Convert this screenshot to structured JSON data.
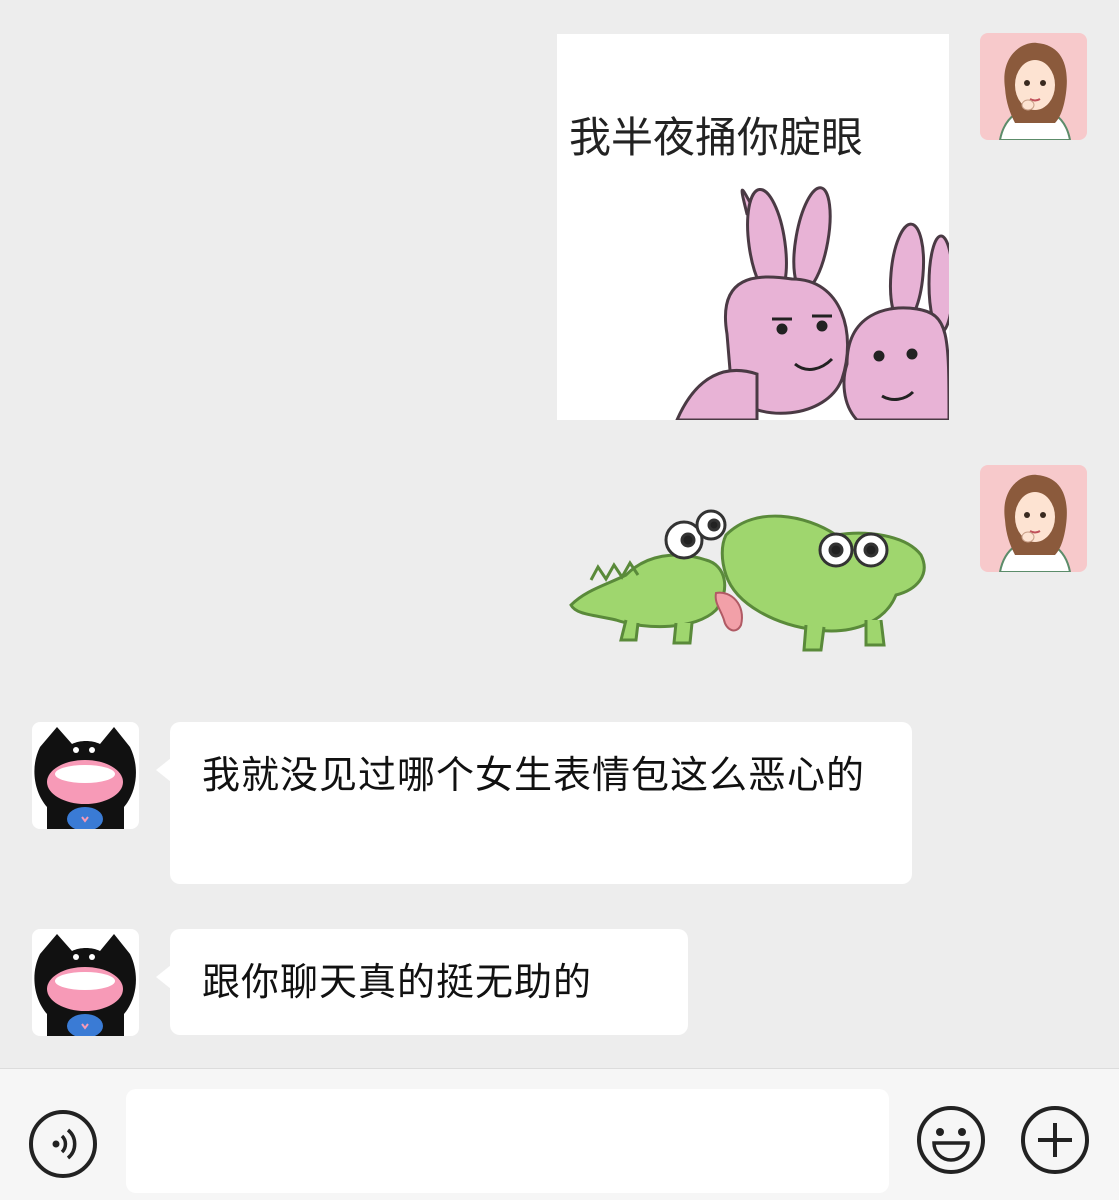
{
  "messages": [
    {
      "sender": "self",
      "type": "sticker",
      "sticker_name": "pink-rabbits-sticker",
      "caption": "我半夜捅你腚眼"
    },
    {
      "sender": "self",
      "type": "sticker",
      "sticker_name": "green-crocodiles-sticker"
    },
    {
      "sender": "other",
      "type": "text",
      "text": "我就没见过哪个女生表情包这么恶心的"
    },
    {
      "sender": "other",
      "type": "text",
      "text": "跟你聊天真的挺无助的"
    }
  ],
  "input_bar": {
    "value": "",
    "voice_icon": "voice-icon",
    "emoji_icon": "emoji-icon",
    "plus_icon": "plus-icon"
  },
  "colors": {
    "background": "#ededed",
    "bubble": "#ffffff",
    "input_bar": "#f6f6f6",
    "rabbit_pink": "#e8b3d6",
    "crocodile_green": "#9fd66e"
  }
}
